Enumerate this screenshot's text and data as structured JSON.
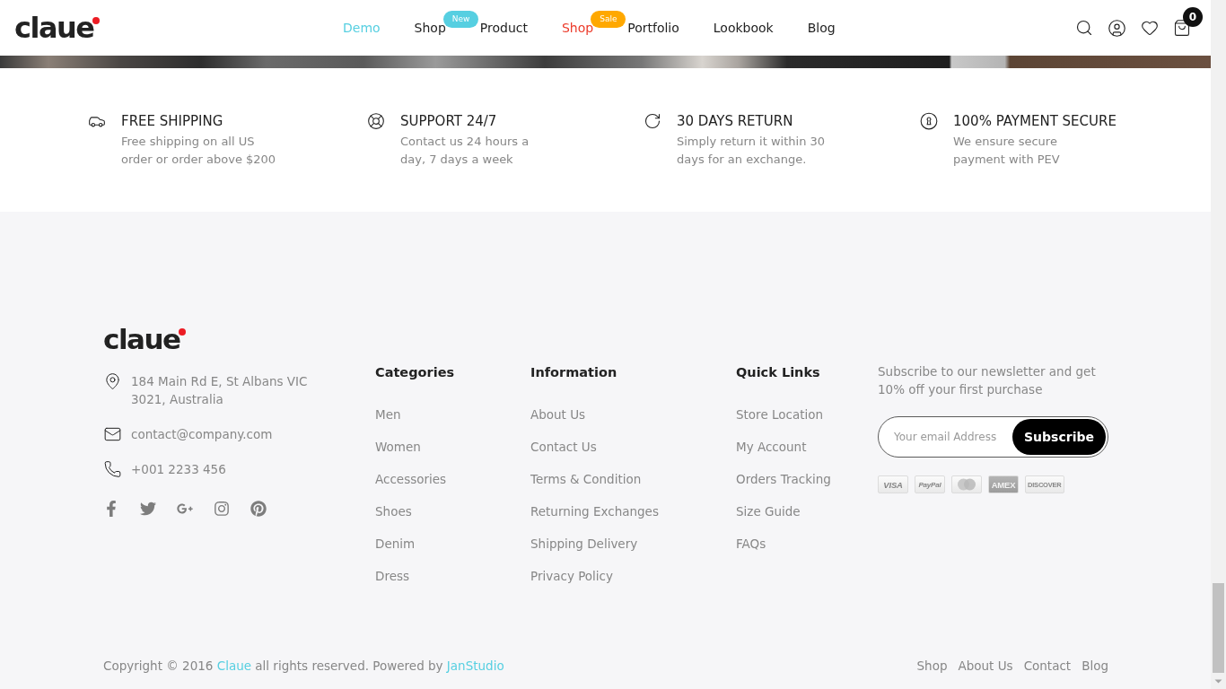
{
  "header": {
    "logo": "claue",
    "nav": [
      {
        "label": "Demo",
        "selected": true
      },
      {
        "label": "Shop",
        "selected": false,
        "badge": {
          "label": "New",
          "color": "#56cfe1"
        }
      },
      {
        "label": "Product",
        "selected": false
      },
      {
        "label": "Shop",
        "selected": false,
        "color": "#ec3b2b",
        "badge": {
          "label": "Sale",
          "color": "#ffa800"
        }
      },
      {
        "label": "Portfolio",
        "selected": false
      },
      {
        "label": "Lookbook",
        "selected": false
      },
      {
        "label": "Blog",
        "selected": false
      }
    ],
    "cart_count": "0"
  },
  "features": [
    {
      "kind": "car",
      "title": "FREE SHIPPING",
      "text": "Free shipping on all US\norder or order above $200"
    },
    {
      "kind": "lifebuoy",
      "title": "SUPPORT 24/7",
      "text": "Contact us 24 hours a\nday, 7 days a week"
    },
    {
      "kind": "return",
      "title": "30 DAYS RETURN",
      "text": "Simply return it within 30\ndays for an exchange."
    },
    {
      "kind": "keyhole",
      "title": "100% PAYMENT SECURE",
      "text": "We ensure secure\npayment with PEV"
    }
  ],
  "footer": {
    "logo": "claue",
    "contacts": [
      {
        "kind": "address",
        "text": "184 Main Rd E, St Albans VIC\n3021, Australia"
      },
      {
        "kind": "email",
        "text": "contact@company.com"
      },
      {
        "kind": "phone",
        "text": "+001 2233 456"
      }
    ],
    "socials": [
      {
        "kind": "facebook"
      },
      {
        "kind": "twitter"
      },
      {
        "kind": "googleplus"
      },
      {
        "kind": "instagram"
      },
      {
        "kind": "pinterest"
      }
    ],
    "columns": [
      {
        "title": "Categories",
        "links": [
          "Men",
          "Women",
          "Accessories",
          "Shoes",
          "Denim",
          "Dress"
        ]
      },
      {
        "title": "Information",
        "links": [
          "About Us",
          "Contact Us",
          "Terms & Condition",
          "Returning Exchanges",
          "Shipping Delivery",
          "Privacy Policy"
        ]
      },
      {
        "title": "Quick Links",
        "links": [
          "Store Location",
          "My Account",
          "Orders Tracking",
          "Size Guide",
          "FAQs"
        ]
      }
    ],
    "newsletter": {
      "text": "Subscribe to our newsletter and get\n10% off your first purchase",
      "placeholder": "Your email Address",
      "button": "Subscribe",
      "cards": [
        {
          "kind": "plain",
          "label": "VISA"
        },
        {
          "kind": "script",
          "label": "PayPal"
        },
        {
          "kind": "circles"
        },
        {
          "kind": "inverse",
          "label": "AMEX"
        },
        {
          "kind": "plain",
          "label": "DISCOVER"
        }
      ]
    },
    "copyright": [
      {
        "kind": "text",
        "text": "Copyright © 2016 "
      },
      {
        "kind": "link",
        "text": "Claue"
      },
      {
        "kind": "text",
        "text": " all rights reserved. Powered by "
      },
      {
        "kind": "link",
        "text": "JanStudio"
      }
    ],
    "bottom_links": [
      "Shop",
      "About Us",
      "Contact",
      "Blog"
    ]
  }
}
